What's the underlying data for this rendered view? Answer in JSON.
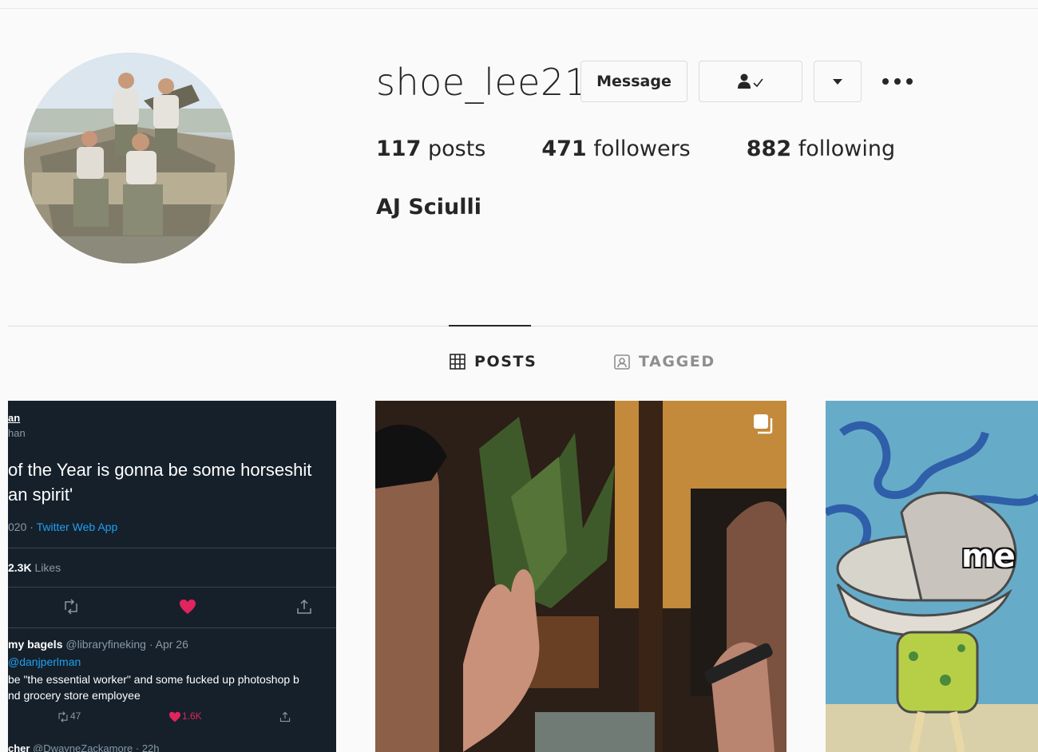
{
  "profile": {
    "username": "shoe_lee21",
    "full_name": "AJ Sciulli",
    "avatar_icon": "profile-photo",
    "stats": {
      "posts_count": "117",
      "posts_label": "posts",
      "followers_count": "471",
      "followers_label": "followers",
      "following_count": "882",
      "following_label": "following"
    }
  },
  "actions": {
    "message_label": "Message",
    "following_icon": "person-check-icon",
    "dropdown_icon": "caret-down-icon",
    "more_icon": "more-dots-icon"
  },
  "tabs": [
    {
      "label": "POSTS",
      "icon": "grid-icon",
      "active": true
    },
    {
      "label": "TAGGED",
      "icon": "tagged-icon",
      "active": false
    }
  ],
  "posts": {
    "tweet": {
      "name": "an",
      "handle": "han",
      "line1": "of the Year is gonna be some horseshit",
      "line2": "an spirit'",
      "meta_date": "020 ·",
      "meta_source": "Twitter Web App",
      "likes_count": "2.3K",
      "likes_label": "Likes",
      "reply_name": "my bagels",
      "reply_handle": "@libraryfineking · Apr 26",
      "reply_to": "@danjperlman",
      "reply_line1": "be \"the essential worker\" and some fucked up photoshop b",
      "reply_line2": "nd grocery store employee",
      "reply_retweets": "47",
      "reply_likes": "1.6K",
      "next_name": "cher",
      "next_handle": "@DwayneZackamore · 22h"
    },
    "photo": {
      "multi_icon": "carousel-icon"
    },
    "meme": {
      "caption": "me"
    }
  },
  "colors": {
    "background": "#fafafa",
    "text": "#262626",
    "muted": "#8e8e8e",
    "tweet_bg": "#15202b",
    "like_red": "#e0245e",
    "link_blue": "#1da1f2"
  }
}
